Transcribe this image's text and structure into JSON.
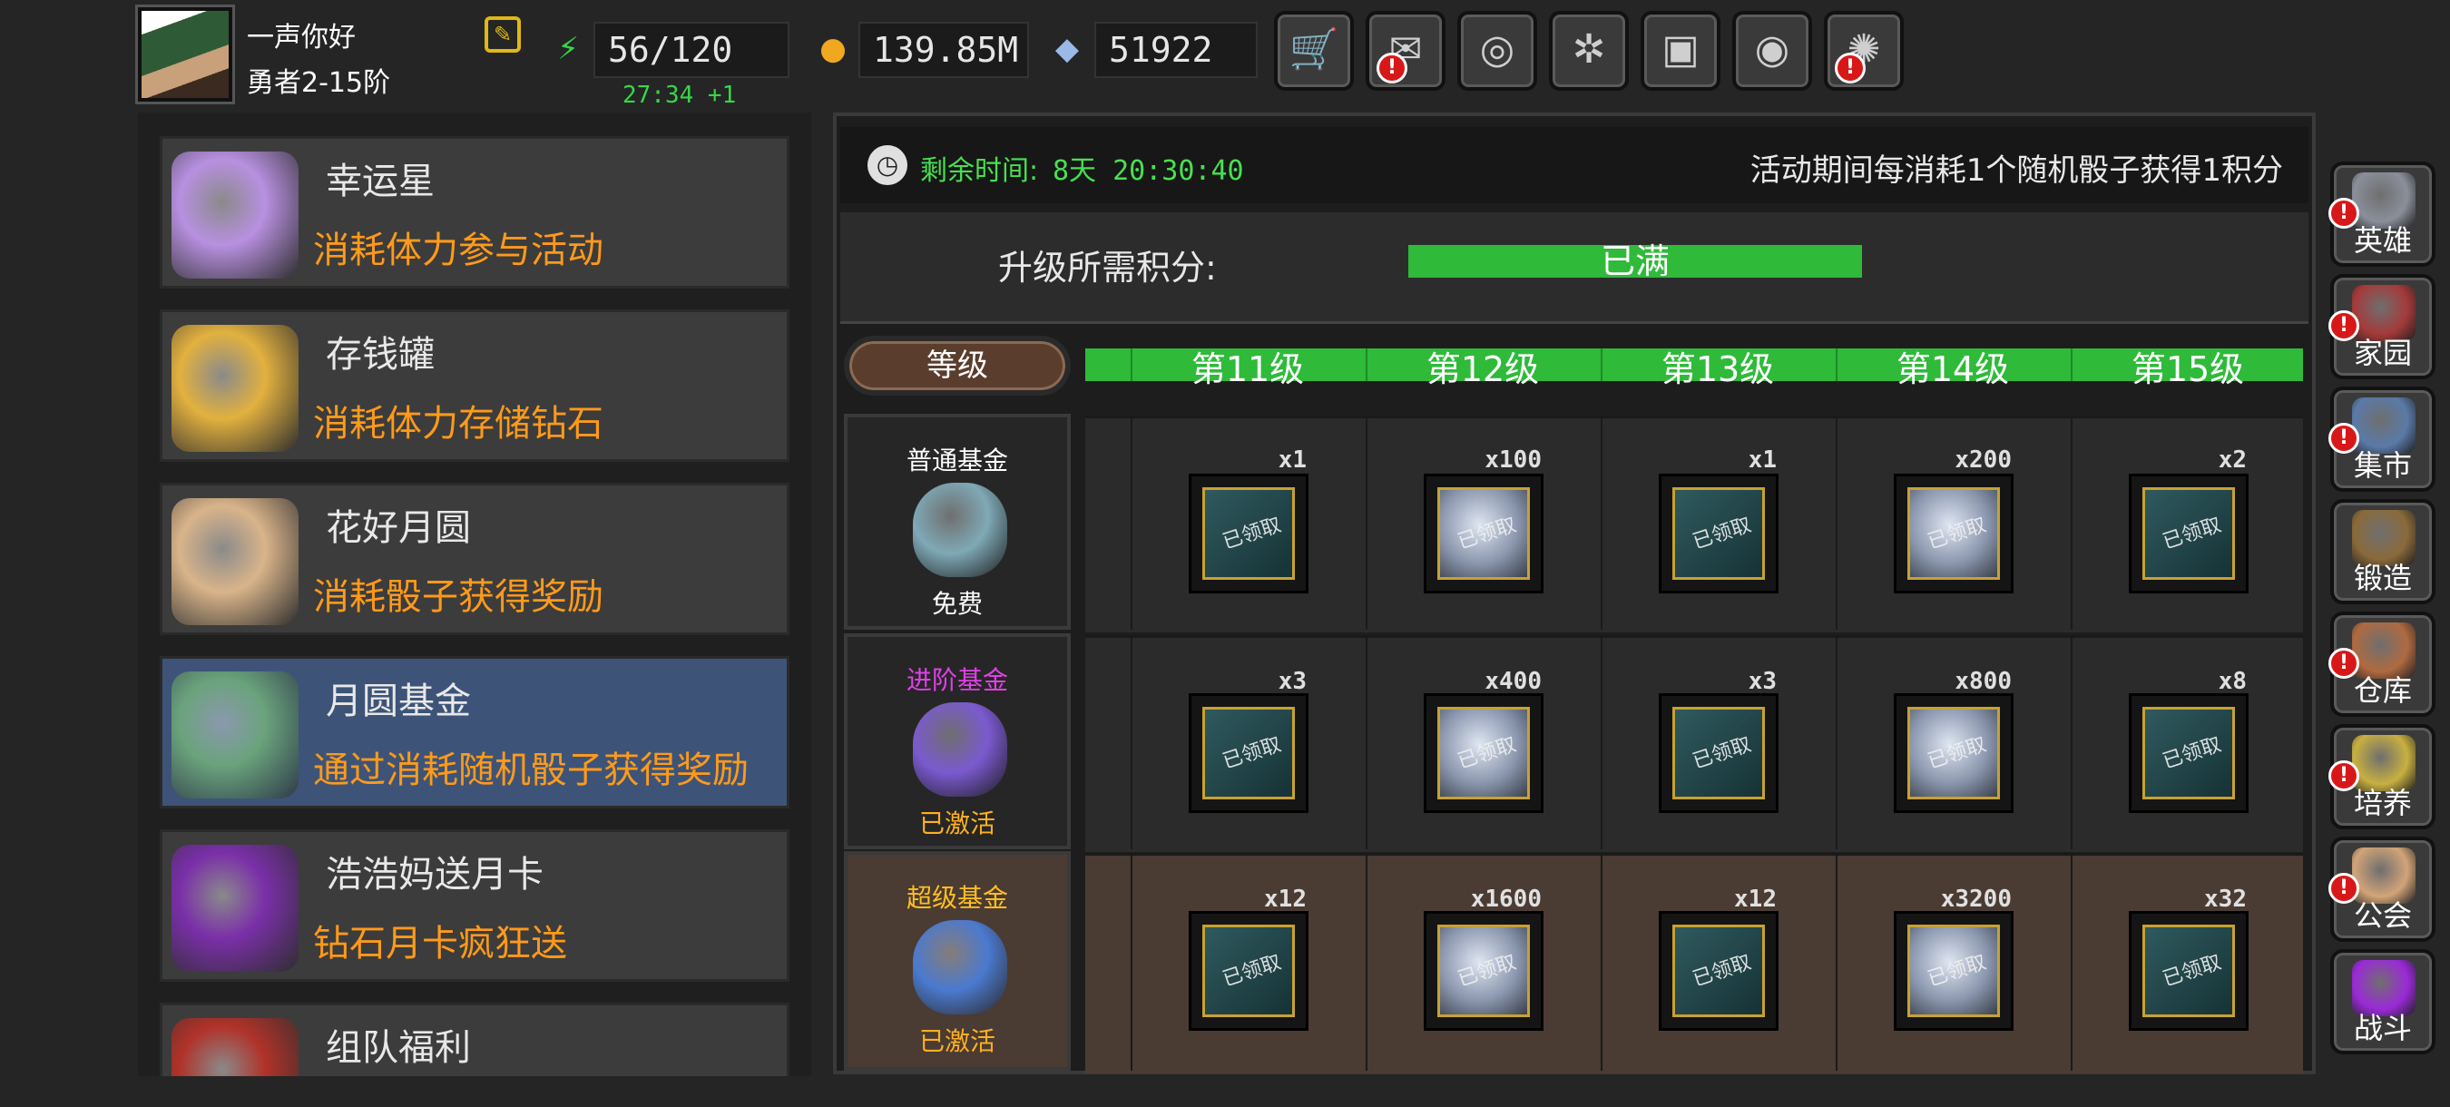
{
  "player": {
    "name": "一声你好",
    "rank": "勇者2-15阶"
  },
  "resources": {
    "stamina": "56/120",
    "stamina_timer": "27:34 +1",
    "gold": "139.85M",
    "diamonds": "51922"
  },
  "top_buttons": [
    {
      "name": "shop",
      "icon": "cart-icon",
      "alert": false
    },
    {
      "name": "mail",
      "icon": "mail-icon",
      "alert": true
    },
    {
      "name": "gamepad",
      "icon": "gamepad-icon",
      "alert": false
    },
    {
      "name": "settings",
      "icon": "gear-icon",
      "alert": false
    },
    {
      "name": "gift",
      "icon": "gift-icon",
      "alert": false
    },
    {
      "name": "camera",
      "icon": "aperture-icon",
      "alert": false
    },
    {
      "name": "fireworks",
      "icon": "fireworks-icon",
      "alert": true
    }
  ],
  "events": [
    {
      "title": "幸运星",
      "subtitle": "消耗体力参与活动",
      "color": "#b890e0"
    },
    {
      "title": "存钱罐",
      "subtitle": "消耗体力存储钻石",
      "color": "#e2b13f"
    },
    {
      "title": "花好月圆",
      "subtitle": "消耗骰子获得奖励",
      "color": "#d9b48a"
    },
    {
      "title": "月圆基金",
      "subtitle": "通过消耗随机骰子获得奖励",
      "color": "#6aa37c",
      "selected": true
    },
    {
      "title": "浩浩妈送月卡",
      "subtitle": "钻石月卡疯狂送",
      "color": "#7a2fa8"
    },
    {
      "title": "组队福利",
      "subtitle": "",
      "color": "#b0322a"
    }
  ],
  "main": {
    "remaining_label": "剩余时间:",
    "remaining_value": "8天 20:30:40",
    "activity_desc": "活动期间每消耗1个随机骰子获得1积分",
    "upgrade_label": "升级所需积分:",
    "progress_text": "已满",
    "progress_fraction": 1.0,
    "level_header": "等级",
    "levels": [
      "第11级",
      "第12级",
      "第13级",
      "第14级",
      "第15级"
    ],
    "tiers": [
      {
        "name": "普通基金",
        "status": "免费",
        "name_color": "#ffffff",
        "status_color": "#ffffff",
        "bag_color": "#7fa9b6"
      },
      {
        "name": "进阶基金",
        "status": "已激活",
        "name_color": "#e040e8",
        "status_color": "#ffb020",
        "bag_color": "#7b5ad0"
      },
      {
        "name": "超级基金",
        "status": "已激活",
        "name_color": "#ffc020",
        "status_color": "#ffb020",
        "bag_color": "#4a7ad0"
      }
    ],
    "rewards": [
      [
        {
          "qty": "x1",
          "kind": "chest"
        },
        {
          "qty": "x100",
          "kind": "diamond"
        },
        {
          "qty": "x1",
          "kind": "chest"
        },
        {
          "qty": "x200",
          "kind": "diamond"
        },
        {
          "qty": "x2",
          "kind": "chest"
        }
      ],
      [
        {
          "qty": "x3",
          "kind": "chest"
        },
        {
          "qty": "x400",
          "kind": "diamond"
        },
        {
          "qty": "x3",
          "kind": "chest"
        },
        {
          "qty": "x800",
          "kind": "diamond"
        },
        {
          "qty": "x8",
          "kind": "chest"
        }
      ],
      [
        {
          "qty": "x12",
          "kind": "chest"
        },
        {
          "qty": "x1600",
          "kind": "diamond"
        },
        {
          "qty": "x12",
          "kind": "chest"
        },
        {
          "qty": "x3200",
          "kind": "diamond"
        },
        {
          "qty": "x32",
          "kind": "chest"
        }
      ]
    ],
    "claimed_text": "已领取"
  },
  "side_menu": [
    {
      "label": "英雄",
      "alert": true,
      "color": "#8a8f9a"
    },
    {
      "label": "家园",
      "alert": true,
      "color": "#a53a3a"
    },
    {
      "label": "集市",
      "alert": true,
      "color": "#5a7aa8"
    },
    {
      "label": "锻造",
      "alert": false,
      "color": "#8a6a3a"
    },
    {
      "label": "仓库",
      "alert": true,
      "color": "#b06a40"
    },
    {
      "label": "培养",
      "alert": true,
      "color": "#c8b040"
    },
    {
      "label": "公会",
      "alert": true,
      "color": "#d2a478"
    },
    {
      "label": "战斗",
      "alert": false,
      "color": "#9a2ad8"
    }
  ],
  "alert_mark": "!"
}
